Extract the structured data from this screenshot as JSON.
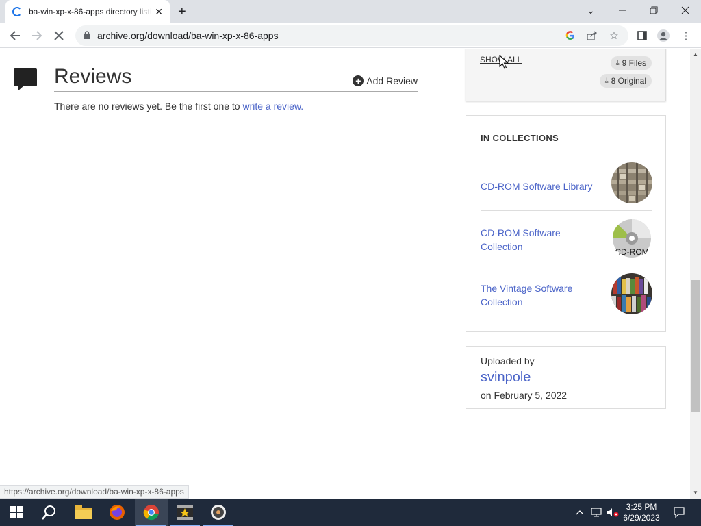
{
  "browser": {
    "tab_title": "ba-win-xp-x-86-apps directory listing",
    "url": "archive.org/download/ba-win-xp-x-86-apps",
    "status_url": "https://archive.org/download/ba-win-xp-x-86-apps"
  },
  "reviews": {
    "title": "Reviews",
    "add_label": "Add Review",
    "empty_text": "There are no reviews yet. Be the first one to ",
    "empty_link": "write a review."
  },
  "files_box": {
    "show_all": "SHOW ALL",
    "files_count": "9 Files",
    "original_count": "8 Original"
  },
  "collections": {
    "heading": "IN COLLECTIONS",
    "items": [
      {
        "title": "CD-ROM Software Library"
      },
      {
        "title": "CD-ROM Software Collection"
      },
      {
        "title": "The Vintage Software Collection"
      }
    ],
    "cd_label": "CD-ROM"
  },
  "uploader": {
    "label": "Uploaded by",
    "user": "svinpole",
    "date": "on February 5, 2022"
  },
  "taskbar": {
    "time": "3:25 PM",
    "date": "6/29/2023"
  },
  "colors": {
    "link": "#4b64c8",
    "taskbar": "#1f2a3b"
  }
}
